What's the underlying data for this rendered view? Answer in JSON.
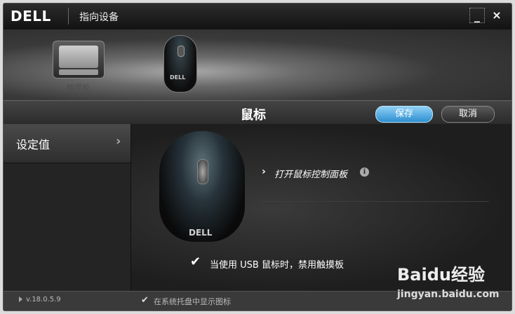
{
  "window": {
    "logo": "DELL",
    "title": "指向设备",
    "minimize": "_",
    "close": "×"
  },
  "devices": {
    "touchpad_label": "触摸板",
    "mouse_logo": "DELL"
  },
  "toolbar": {
    "title": "鼠标",
    "save_label": "保存",
    "cancel_label": "取消"
  },
  "sidebar": {
    "items": [
      {
        "label": "设定值",
        "arrow": "›"
      }
    ]
  },
  "main": {
    "mouse_logo": "DELL",
    "link_text": "打开鼠标控制面板",
    "link_chevron": "›",
    "info": "i",
    "checkbox": {
      "checked": true,
      "label": "当使用 USB 鼠标时，禁用触摸板",
      "mark": "✔"
    }
  },
  "status": {
    "version": "v.18.0.5.9",
    "tray": {
      "checked": true,
      "label": "在系统托盘中显示图标",
      "mark": "✔"
    }
  },
  "watermark": {
    "brand": "Baidu经验",
    "url": "jingyan.baidu.com"
  }
}
